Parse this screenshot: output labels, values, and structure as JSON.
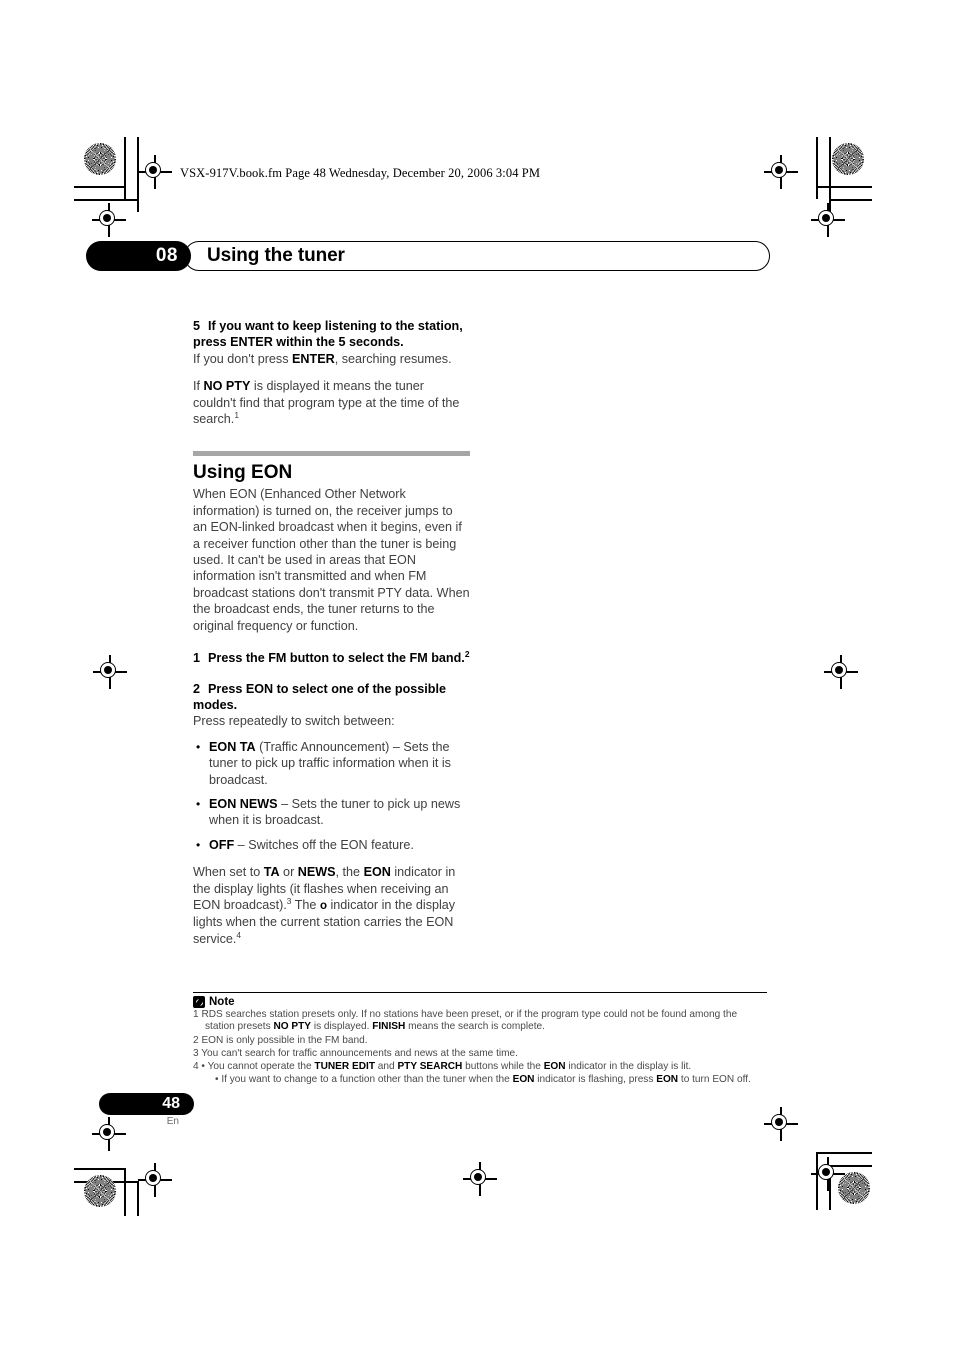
{
  "page": {
    "filename_header": "VSX-917V.book.fm  Page 48  Wednesday, December 20, 2006  3:04 PM",
    "number": "48",
    "language": "En"
  },
  "chapter": {
    "number": "08",
    "title": "Using the tuner"
  },
  "step5": {
    "num": "5",
    "heading": "If you want to keep listening to the station, press ENTER within the 5 seconds.",
    "para1_pre": "If you don't press ",
    "para1_bold": "ENTER",
    "para1_post": ", searching resumes.",
    "para2_pre": "If ",
    "para2_bold": "NO PTY",
    "para2_post": " is displayed it means the tuner couldn't find that program type at the time of the search.",
    "para2_footnote": "1"
  },
  "section": {
    "heading": "Using EON",
    "intro": "When EON (Enhanced Other Network information) is turned on, the receiver jumps to an EON-linked broadcast when it begins, even if a receiver function other than the tuner is being used. It can't be used in areas that EON information isn't transmitted and when FM broadcast stations don't transmit PTY data. When the broadcast ends, the tuner returns to the original frequency or function."
  },
  "step1": {
    "num": "1",
    "heading": "Press the FM button to select the FM band.",
    "footnote": "2"
  },
  "step2": {
    "num": "2",
    "heading": "Press EON to select one of the possible modes.",
    "para": "Press repeatedly to switch between:"
  },
  "bullets": [
    {
      "bold": "EON TA",
      "text": " (Traffic Announcement) – Sets the tuner to pick up traffic information when it is broadcast."
    },
    {
      "bold": "EON NEWS",
      "text": " – Sets the tuner to pick up news when it is broadcast."
    },
    {
      "bold": "OFF",
      "text": " – Switches off the EON feature."
    }
  ],
  "indicator_para": {
    "p1": "When set to ",
    "b1": "TA",
    "p2": " or ",
    "b2": "NEWS",
    "p3": ", the ",
    "b3": "EON",
    "p4": " indicator in the display lights (it flashes when receiving an EON broadcast).",
    "fn3": "3",
    "p5": " The ",
    "symbol": "o",
    "p6": " indicator in the display lights when the current station carries the EON service.",
    "fn4": "4"
  },
  "notes": {
    "title": "Note",
    "n1_num": "1",
    "n1_a": "RDS searches station presets only. If no stations have been preset, or if the program type could not be found among the station presets ",
    "n1_b1": "NO PTY",
    "n1_b": " is displayed. ",
    "n1_b2": "FINISH",
    "n1_c": " means the search is complete.",
    "n2_num": "2",
    "n2_text": "EON is only possible in the FM band.",
    "n3_num": "3",
    "n3_text": "You can't search for traffic announcements and news at the same time.",
    "n4_num": "4",
    "n4_a": "You cannot operate the ",
    "n4_b1": "TUNER EDIT",
    "n4_b": " and ",
    "n4_b2": "PTY SEARCH",
    "n4_c": " buttons while the ",
    "n4_b3": "EON",
    "n4_d": " indicator in the display is lit.",
    "n5_a": "If you want to change to a function other than the tuner when the ",
    "n5_b1": "EON",
    "n5_b": " indicator is flashing, press ",
    "n5_b2": "EON",
    "n5_c": " to turn EON off."
  }
}
